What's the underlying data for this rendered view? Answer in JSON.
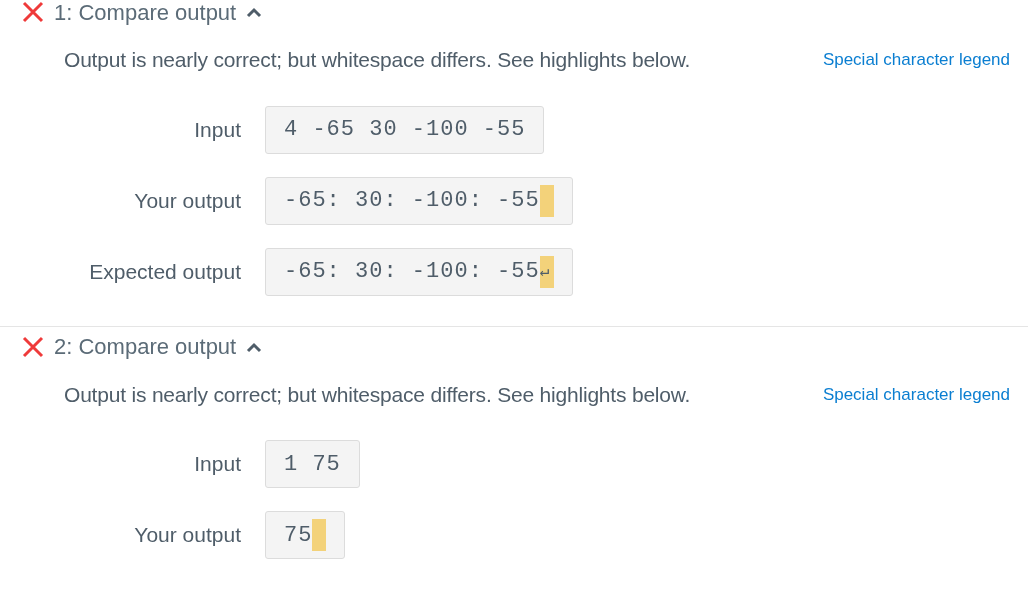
{
  "tests": [
    {
      "title": "1: Compare output",
      "passed": false,
      "expanded": true,
      "message": "Output is nearly correct; but whitespace differs. See highlights below.",
      "legend_link": "Special character legend",
      "rows": [
        {
          "label": "Input",
          "text": "4 -65 30 -100 -55",
          "highlight": false
        },
        {
          "label": "Your output",
          "text": "-65: 30: -100: -55",
          "highlight": true
        },
        {
          "label": "Expected output",
          "text": "-65: 30: -100: -55",
          "highlight": true,
          "highlight_text": "↵"
        }
      ]
    },
    {
      "title": "2: Compare output",
      "passed": false,
      "expanded": true,
      "message": "Output is nearly correct; but whitespace differs. See highlights below.",
      "legend_link": "Special character legend",
      "rows": [
        {
          "label": "Input",
          "text": "1 75",
          "highlight": false
        },
        {
          "label": "Your output",
          "text": "75",
          "highlight": true
        }
      ]
    }
  ]
}
